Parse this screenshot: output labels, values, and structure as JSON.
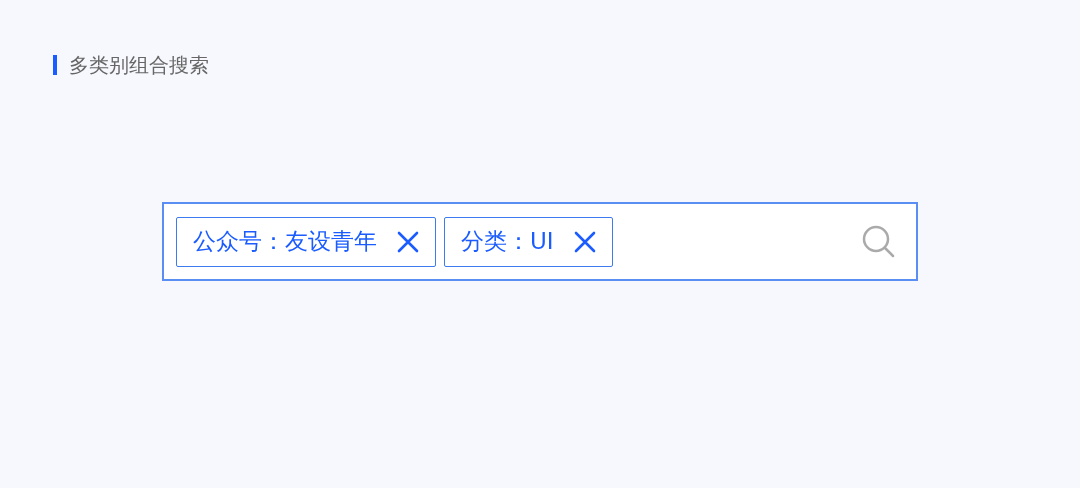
{
  "section": {
    "title": "多类别组合搜索"
  },
  "search": {
    "tags": [
      {
        "label": "公众号：友设青年"
      },
      {
        "label": "分类：UI"
      }
    ]
  }
}
